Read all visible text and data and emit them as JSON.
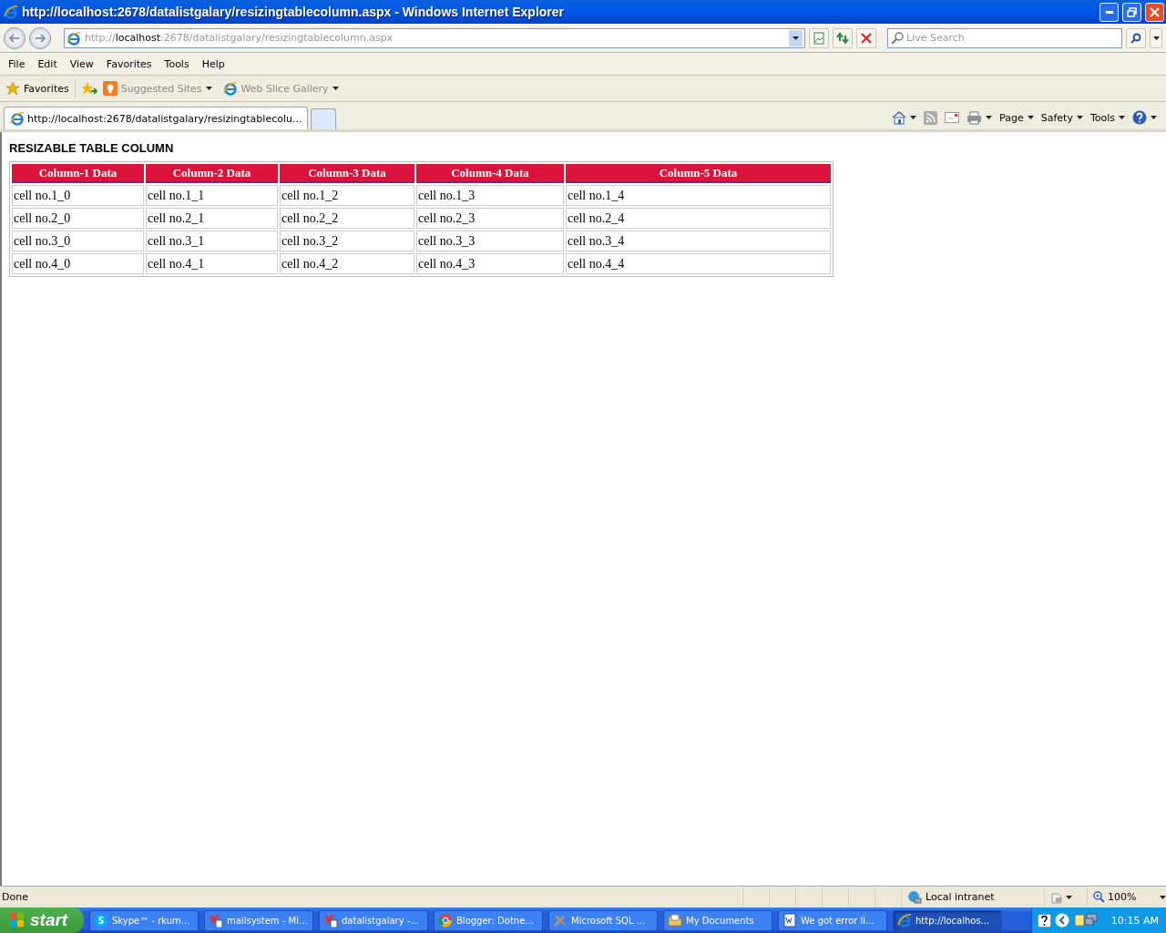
{
  "window": {
    "title": "http://localhost:2678/datalistgalary/resizingtablecolumn.aspx - Windows Internet Explorer"
  },
  "address": {
    "scheme": "http://",
    "host": "localhost",
    "path": ":2678/datalistgalary/resizingtablecolumn.aspx"
  },
  "search": {
    "placeholder": "Live Search"
  },
  "menu": [
    "File",
    "Edit",
    "View",
    "Favorites",
    "Tools",
    "Help"
  ],
  "favorites_bar": {
    "favorites": "Favorites",
    "links": [
      "Suggested Sites",
      "Web Slice Gallery"
    ]
  },
  "tabs": [
    {
      "label": "http://localhost:2678/datalistgalary/resizingtablecolu...",
      "selected": true
    }
  ],
  "command_bar": [
    "Page",
    "Safety",
    "Tools"
  ],
  "page": {
    "heading": "RESIZABLE TABLE COLUMN",
    "table": {
      "columns": [
        "Column-1 Data",
        "Column-2 Data",
        "Column-3 Data",
        "Column-4 Data",
        "Column-5 Data"
      ],
      "rows": [
        [
          "cell no.1_0",
          "cell no.1_1",
          "cell no.1_2",
          "cell no.1_3",
          "cell no.1_4"
        ],
        [
          "cell no.2_0",
          "cell no.2_1",
          "cell no.2_2",
          "cell no.2_3",
          "cell no.2_4"
        ],
        [
          "cell no.3_0",
          "cell no.3_1",
          "cell no.3_2",
          "cell no.3_3",
          "cell no.3_4"
        ],
        [
          "cell no.4_0",
          "cell no.4_1",
          "cell no.4_2",
          "cell no.4_3",
          "cell no.4_4"
        ]
      ]
    }
  },
  "status_bar": {
    "status": "Done",
    "zone": "Local intranet",
    "zoom": "100%"
  },
  "taskbar": {
    "start": "start",
    "items": [
      {
        "label": "Skype™ - rkum...",
        "kind": "chat",
        "selected": false
      },
      {
        "label": "mailsystem - Mi...",
        "kind": "db",
        "selected": false
      },
      {
        "label": "datalistgalary -...",
        "kind": "db",
        "selected": false
      },
      {
        "label": "Blogger: Dotne...",
        "kind": "browser",
        "selected": false
      },
      {
        "label": "Microsoft SQL ...",
        "kind": "tool",
        "selected": false
      },
      {
        "label": "My Documents",
        "kind": "folder",
        "selected": false
      },
      {
        "label": "We got error  li...",
        "kind": "document",
        "selected": false
      },
      {
        "label": "http://localhos...",
        "kind": "web",
        "selected": true
      }
    ],
    "clock": "10:15 AM"
  }
}
